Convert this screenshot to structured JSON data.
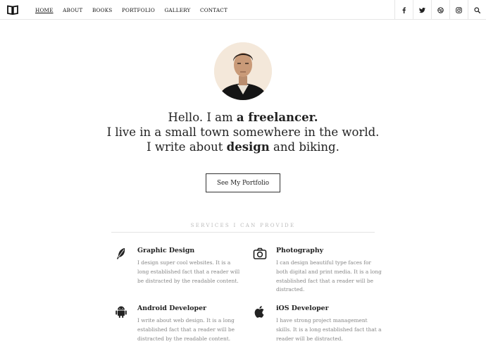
{
  "nav": {
    "items": [
      {
        "label": "HOME",
        "active": true
      },
      {
        "label": "ABOUT",
        "active": false
      },
      {
        "label": "BOOKS",
        "active": false
      },
      {
        "label": "PORTFOLIO",
        "active": false
      },
      {
        "label": "GALLERY",
        "active": false
      },
      {
        "label": "CONTACT",
        "active": false
      }
    ],
    "logo_icon": "open-book-icon",
    "social_icons": [
      "facebook-icon",
      "twitter-icon",
      "dribbble-icon",
      "instagram-icon",
      "search-icon"
    ]
  },
  "hero": {
    "line1_pre": "Hello. I am ",
    "line1_bold": "a freelancer.",
    "line2": "I live in a small town somewhere in the world.",
    "line3_pre": "I write about ",
    "line3_bold": "design",
    "line3_post": " and biking.",
    "cta_label": "See My Portfolio"
  },
  "services": {
    "heading": "SERVICES I CAN PROVIDE",
    "items": [
      {
        "title": "Graphic Design",
        "icon": "feather-icon",
        "text": "I design super cool websites. It is a long established fact that a reader will be distracted by the readable content."
      },
      {
        "title": "Photography",
        "icon": "camera-icon",
        "text": "I can design beautiful type faces for both digital and print media. It is a long established fact that a reader will be distracted."
      },
      {
        "title": "Android Developer",
        "icon": "android-icon",
        "text": "I write about web design. It is a long established fact that a reader will be distracted by the readable content."
      },
      {
        "title": "iOS Developer",
        "icon": "apple-icon",
        "text": "I have strong project management skills. It is a long established fact that a reader will be distracted."
      }
    ]
  },
  "colors": {
    "text": "#222222",
    "muted": "#888888",
    "rule": "#e4e4e4"
  }
}
